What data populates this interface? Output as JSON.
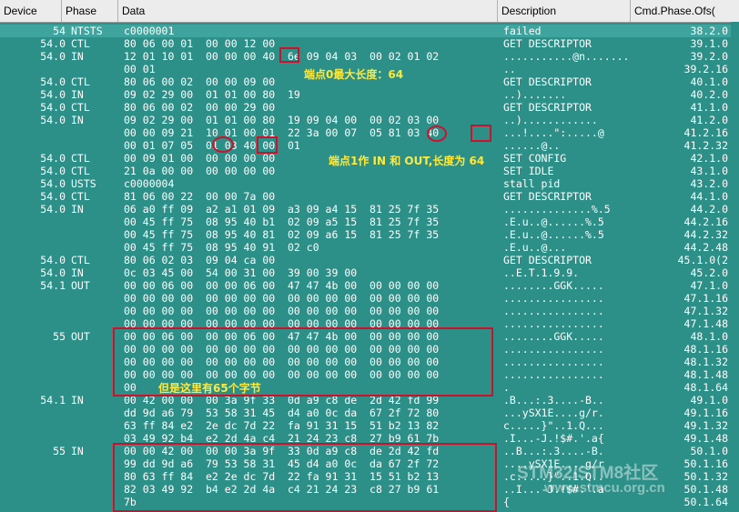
{
  "columns": [
    "Device",
    "Phase",
    "Data",
    "Description",
    "Cmd.Phase.Ofs("
  ],
  "rows": [
    {
      "device": "54",
      "phase": "NTSTS",
      "data": "c0000001",
      "desc": "failed",
      "cmd": "38.2.0",
      "selected": true
    },
    {
      "device": "54.0",
      "phase": "CTL",
      "data": "80 06 00 01  00 00 12 00",
      "desc": "GET DESCRIPTOR",
      "cmd": "39.1.0"
    },
    {
      "device": "54.0",
      "phase": "IN",
      "data": "12 01 10 01  00 00 00 40  6e 09 04 03  00 02 01 02",
      "desc": "...........@n.......",
      "cmd": "39.2.0"
    },
    {
      "device": "",
      "phase": "",
      "data": "00 01",
      "desc": "..",
      "cmd": "39.2.16"
    },
    {
      "device": "54.0",
      "phase": "CTL",
      "data": "80 06 00 02  00 00 09 00",
      "desc": "GET DESCRIPTOR",
      "cmd": "40.1.0"
    },
    {
      "device": "54.0",
      "phase": "IN",
      "data": "09 02 29 00  01 01 00 80  19",
      "desc": "..).......",
      "cmd": "40.2.0"
    },
    {
      "device": "54.0",
      "phase": "CTL",
      "data": "80 06 00 02  00 00 29 00",
      "desc": "GET DESCRIPTOR",
      "cmd": "41.1.0"
    },
    {
      "device": "54.0",
      "phase": "IN",
      "data": "09 02 29 00  01 01 00 80  19 09 04 00  00 02 03 00",
      "desc": "..)............",
      "cmd": "41.2.0"
    },
    {
      "device": "",
      "phase": "",
      "data": "00 00 09 21  10 01 00 01  22 3a 00 07  05 81 03 40",
      "desc": "...!....\":.....@",
      "cmd": "41.2.16"
    },
    {
      "device": "",
      "phase": "",
      "data": "00 01 07 05  01 03 40 00  01",
      "desc": "......@..",
      "cmd": "41.2.32"
    },
    {
      "device": "54.0",
      "phase": "CTL",
      "data": "00 09 01 00  00 00 00 00",
      "desc": "SET CONFIG",
      "cmd": "42.1.0"
    },
    {
      "device": "54.0",
      "phase": "CTL",
      "data": "21 0a 00 00  00 00 00 00",
      "desc": "SET IDLE",
      "cmd": "43.1.0"
    },
    {
      "device": "54.0",
      "phase": "USTS",
      "data": "c0000004",
      "desc": "stall pid",
      "cmd": "43.2.0"
    },
    {
      "device": "54.0",
      "phase": "CTL",
      "data": "81 06 00 22  00 00 7a 00",
      "desc": "GET DESCRIPTOR",
      "cmd": "44.1.0"
    },
    {
      "device": "54.0",
      "phase": "IN",
      "data": "06 a0 ff 09  a2 a1 01 09  a3 09 a4 15  81 25 7f 35",
      "desc": "..............%.5",
      "cmd": "44.2.0"
    },
    {
      "device": "",
      "phase": "",
      "data": "00 45 ff 75  08 95 40 b1  02 09 a5 15  81 25 7f 35",
      "desc": ".E.u..@......%.5",
      "cmd": "44.2.16"
    },
    {
      "device": "",
      "phase": "",
      "data": "00 45 ff 75  08 95 40 81  02 09 a6 15  81 25 7f 35",
      "desc": ".E.u..@......%.5",
      "cmd": "44.2.32"
    },
    {
      "device": "",
      "phase": "",
      "data": "00 45 ff 75  08 95 40 91  02 c0",
      "desc": ".E.u..@...",
      "cmd": "44.2.48"
    },
    {
      "device": "54.0",
      "phase": "CTL",
      "data": "80 06 02 03  09 04 ca 00",
      "desc": "GET DESCRIPTOR",
      "cmd": "45.1.0(2"
    },
    {
      "device": "54.0",
      "phase": "IN",
      "data": "0c 03 45 00  54 00 31 00  39 00 39 00",
      "desc": "..E.T.1.9.9.",
      "cmd": "45.2.0"
    },
    {
      "device": "54.1",
      "phase": "OUT",
      "data": "00 00 06 00  00 00 06 00  47 47 4b 00  00 00 00 00",
      "desc": "........GGK.....",
      "cmd": "47.1.0"
    },
    {
      "device": "",
      "phase": "",
      "data": "00 00 00 00  00 00 00 00  00 00 00 00  00 00 00 00",
      "desc": "................",
      "cmd": "47.1.16"
    },
    {
      "device": "",
      "phase": "",
      "data": "00 00 00 00  00 00 00 00  00 00 00 00  00 00 00 00",
      "desc": "................",
      "cmd": "47.1.32"
    },
    {
      "device": "",
      "phase": "",
      "data": "00 00 00 00  00 00 00 00  00 00 00 00  00 00 00 00",
      "desc": "................",
      "cmd": "47.1.48"
    },
    {
      "device": "55",
      "phase": "OUT",
      "data": "00 00 06 00  00 00 06 00  47 47 4b 00  00 00 00 00",
      "desc": "........GGK.....",
      "cmd": "48.1.0"
    },
    {
      "device": "",
      "phase": "",
      "data": "00 00 00 00  00 00 00 00  00 00 00 00  00 00 00 00",
      "desc": "................",
      "cmd": "48.1.16"
    },
    {
      "device": "",
      "phase": "",
      "data": "00 00 00 00  00 00 00 00  00 00 00 00  00 00 00 00",
      "desc": "................",
      "cmd": "48.1.32"
    },
    {
      "device": "",
      "phase": "",
      "data": "00 00 00 00  00 00 00 00  00 00 00 00  00 00 00 00",
      "desc": "................",
      "cmd": "48.1.48"
    },
    {
      "device": "",
      "phase": "",
      "data": "00",
      "desc": ".",
      "cmd": "48.1.64"
    },
    {
      "device": "54.1",
      "phase": "IN",
      "data": "00 42 00 00  00 3a 9f 33  0d a9 c8 de  2d 42 fd 99",
      "desc": ".B...:.3....-B..",
      "cmd": "49.1.0"
    },
    {
      "device": "",
      "phase": "",
      "data": "dd 9d a6 79  53 58 31 45  d4 a0 0c da  67 2f 72 80",
      "desc": "...ySX1E....g/r.",
      "cmd": "49.1.16"
    },
    {
      "device": "",
      "phase": "",
      "data": "63 ff 84 e2  2e dc 7d 22  fa 91 31 15  51 b2 13 82",
      "desc": "c.....}\"..1.Q...",
      "cmd": "49.1.32"
    },
    {
      "device": "",
      "phase": "",
      "data": "03 49 92 b4  e2 2d 4a c4  21 24 23 c8  27 b9 61 7b",
      "desc": ".I...-J.!$#.'.a{",
      "cmd": "49.1.48"
    },
    {
      "device": "55",
      "phase": "IN",
      "data": "00 00 42 00  00 00 3a 9f  33 0d a9 c8  de 2d 42 fd",
      "desc": "..B...:.3....-B.",
      "cmd": "50.1.0"
    },
    {
      "device": "",
      "phase": "",
      "data": "99 dd 9d a6  79 53 58 31  45 d4 a0 0c  da 67 2f 72",
      "desc": "....ySX1E....g/r",
      "cmd": "50.1.16"
    },
    {
      "device": "",
      "phase": "",
      "data": "80 63 ff 84  e2 2e dc 7d  22 fa 91 31  15 51 b2 13",
      "desc": ".c.....}\"..1.Q..",
      "cmd": "50.1.32"
    },
    {
      "device": "",
      "phase": "",
      "data": "82 03 49 92  b4 e2 2d 4a  c4 21 24 23  c8 27 b9 61",
      "desc": "..I...-J.!$#.'.a",
      "cmd": "50.1.48"
    },
    {
      "device": "",
      "phase": "",
      "data": "7b",
      "desc": "{",
      "cmd": "50.1.64"
    }
  ],
  "annotations": {
    "endpoint0": "端点0最大长度：64",
    "endpoint1": "端点1作 IN 和 OUT,长度为 64",
    "bytes65": "但是这里有65个字节"
  },
  "watermark": {
    "brand": "STM32/STM8社区",
    "url": "www.stmcu.org.cn"
  },
  "colors": {
    "background": "#2c8f88",
    "text": "#ffffff",
    "annotation_box": "#d0102a",
    "annotation_text": "#ffe93a",
    "header_bg": "#ececec"
  }
}
